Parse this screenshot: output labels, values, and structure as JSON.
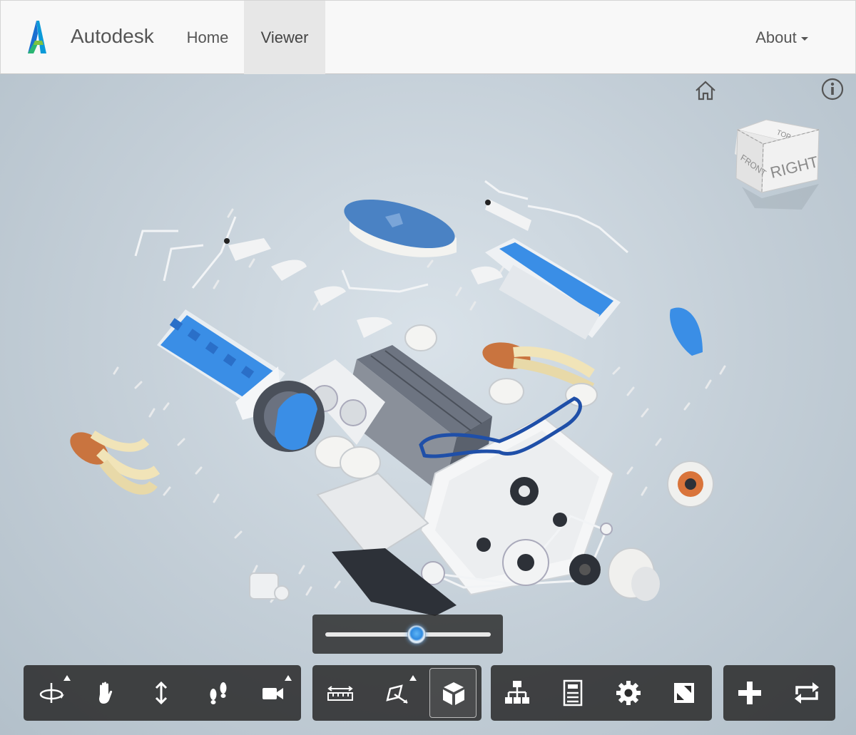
{
  "navbar": {
    "brand": "Autodesk",
    "links": [
      {
        "label": "Home",
        "active": false
      },
      {
        "label": "Viewer",
        "active": true
      }
    ],
    "about_label": "About"
  },
  "viewcube": {
    "top_label": "TOP",
    "front_label": "FRONT",
    "right_label": "RIGHT"
  },
  "explode_slider": {
    "value": 0.55
  },
  "toolbar": {
    "navigation_tools": [
      "orbit-icon",
      "pan-hand-icon",
      "dolly-icon",
      "walk-footprints-icon",
      "camera-icon"
    ],
    "modeling_tools": [
      "measure-icon",
      "section-icon",
      "explode-cube-icon"
    ],
    "settings_tools": [
      "model-tree-icon",
      "properties-icon",
      "settings-gear-icon",
      "fullscreen-icon"
    ],
    "extension_tools": [
      "add-plus-icon",
      "refresh-loop-icon"
    ],
    "active_tool": "explode-cube-icon"
  },
  "colors": {
    "accent_blue": "#3a8ee6",
    "dark_blue": "#1f4fa8",
    "toolbar_bg": "#282828",
    "viewer_bg": "#c3ced7"
  }
}
